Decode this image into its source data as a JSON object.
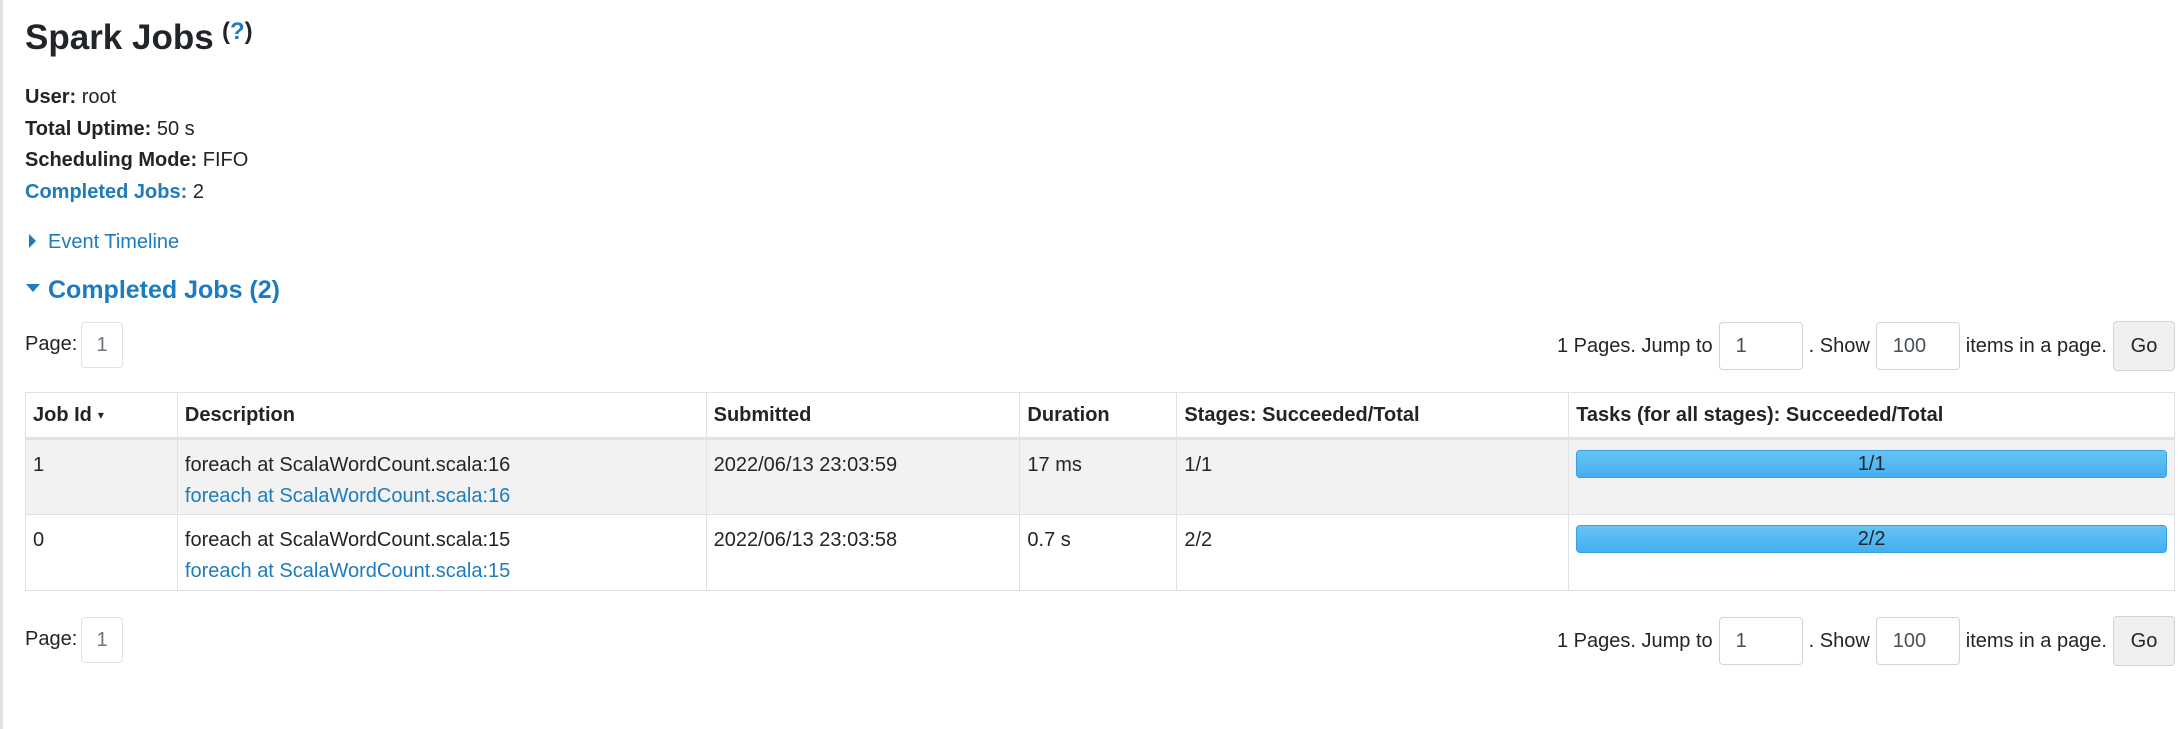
{
  "page": {
    "title": "Spark Jobs",
    "help_label": "?"
  },
  "summary": {
    "user_label": "User:",
    "user_value": "root",
    "uptime_label": "Total Uptime:",
    "uptime_value": "50 s",
    "scheduling_label": "Scheduling Mode:",
    "scheduling_value": "FIFO",
    "completed_label": "Completed Jobs:",
    "completed_value": "2"
  },
  "event_timeline": {
    "label": "Event Timeline",
    "expanded": false
  },
  "completed_section": {
    "label": "Completed Jobs (2)",
    "expanded": true
  },
  "pagination": {
    "page_label": "Page:",
    "current_page": "1",
    "pages_text": "1 Pages. Jump to",
    "jump_value": "1",
    "show_text": ". Show",
    "show_value": "100",
    "items_text": "items in a page.",
    "go_label": "Go"
  },
  "table": {
    "headers": {
      "job_id": "Job Id",
      "sort_indicator": "▾",
      "description": "Description",
      "submitted": "Submitted",
      "duration": "Duration",
      "stages": "Stages: Succeeded/Total",
      "tasks": "Tasks (for all stages): Succeeded/Total"
    },
    "rows": [
      {
        "job_id": "1",
        "desc_text": "foreach at ScalaWordCount.scala:16",
        "desc_link": "foreach at ScalaWordCount.scala:16",
        "submitted": "2022/06/13 23:03:59",
        "duration": "17 ms",
        "stages": "1/1",
        "tasks_label": "1/1",
        "tasks_fraction": 1.0
      },
      {
        "job_id": "0",
        "desc_text": "foreach at ScalaWordCount.scala:15",
        "desc_link": "foreach at ScalaWordCount.scala:15",
        "submitted": "2022/06/13 23:03:58",
        "duration": "0.7 s",
        "stages": "2/2",
        "tasks_label": "2/2",
        "tasks_fraction": 1.0
      }
    ]
  },
  "colors": {
    "link": "#1c7cbf",
    "progress": "#5bc0f8",
    "row_stripe": "#f2f2f2"
  }
}
